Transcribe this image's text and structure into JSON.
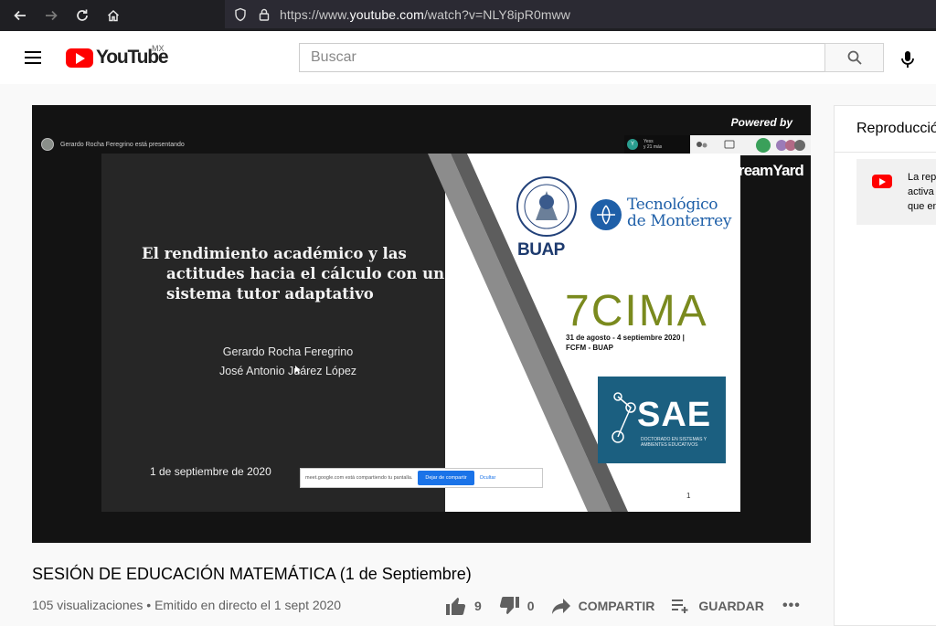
{
  "browser": {
    "url_prefix": "https://www.",
    "url_host": "youtube.com",
    "url_path": "/watch?v=NLY8ipR0mww",
    "icons": [
      "back-icon",
      "forward-icon",
      "reload-icon",
      "home-icon",
      "shield-icon",
      "lock-icon"
    ]
  },
  "masthead": {
    "logo_text": "YouTube",
    "country_code": "MX",
    "search_placeholder": "Buscar",
    "icons": [
      "menu-icon",
      "search-icon",
      "mic-icon"
    ]
  },
  "player": {
    "presenter_text": "Gerardo Rocha Feregrino está presentando",
    "powered_by": "Powered by",
    "streamyard_brand": "StreamYard",
    "viewer_name": "Yess",
    "viewer_more": "y 21 más",
    "viewer_initial": "Y",
    "slide": {
      "title_line1": "El rendimiento académico y las",
      "title_line2": "actitudes hacia el cálculo con un",
      "title_line3": "sistema tutor adaptativo",
      "author1": "Gerardo Rocha Feregrino",
      "author2": "José Antonio Juárez López",
      "date": "1 de septiembre de 2020",
      "buap_label": "BUAP",
      "tec_line1": "Tecnológico",
      "tec_line2": "de Monterrey",
      "cima_label": "7CIMA",
      "cima_sub_line1": "31 de agosto - 4 septiembre 2020 |",
      "cima_sub_line2": "FCFM - BUAP",
      "sae_label": "SAE",
      "sae_sub_line1": "DOCTORADO EN SISTEMAS Y",
      "sae_sub_line2": "AMBIENTES EDUCATIVOS",
      "page_number": "1"
    },
    "share_bar": {
      "message": "meet.google.com está compartiendo tu pantalla.",
      "stop_label": "Dejar de compartir",
      "hide_label": "Ocultar"
    }
  },
  "live_chat": {
    "header": "Reproducción",
    "notice_line1": "La rep",
    "notice_line2": "activa",
    "notice_line3": "que en"
  },
  "video": {
    "title": "SESIÓN DE EDUCACIÓN MATEMÁTICA (1 de Septiembre)",
    "meta": "105 visualizaciones • Emitido en directo el 1 sept 2020",
    "likes": "9",
    "dislikes": "0",
    "share_label": "COMPARTIR",
    "save_label": "GUARDAR",
    "more_label": "•••"
  },
  "colors": {
    "youtube_red": "#ff0000",
    "browser_chrome": "#1f1f23",
    "tec_blue": "#1e5fa8",
    "cima_green": "#7a8a1e",
    "sae_teal": "#1b5f80"
  }
}
